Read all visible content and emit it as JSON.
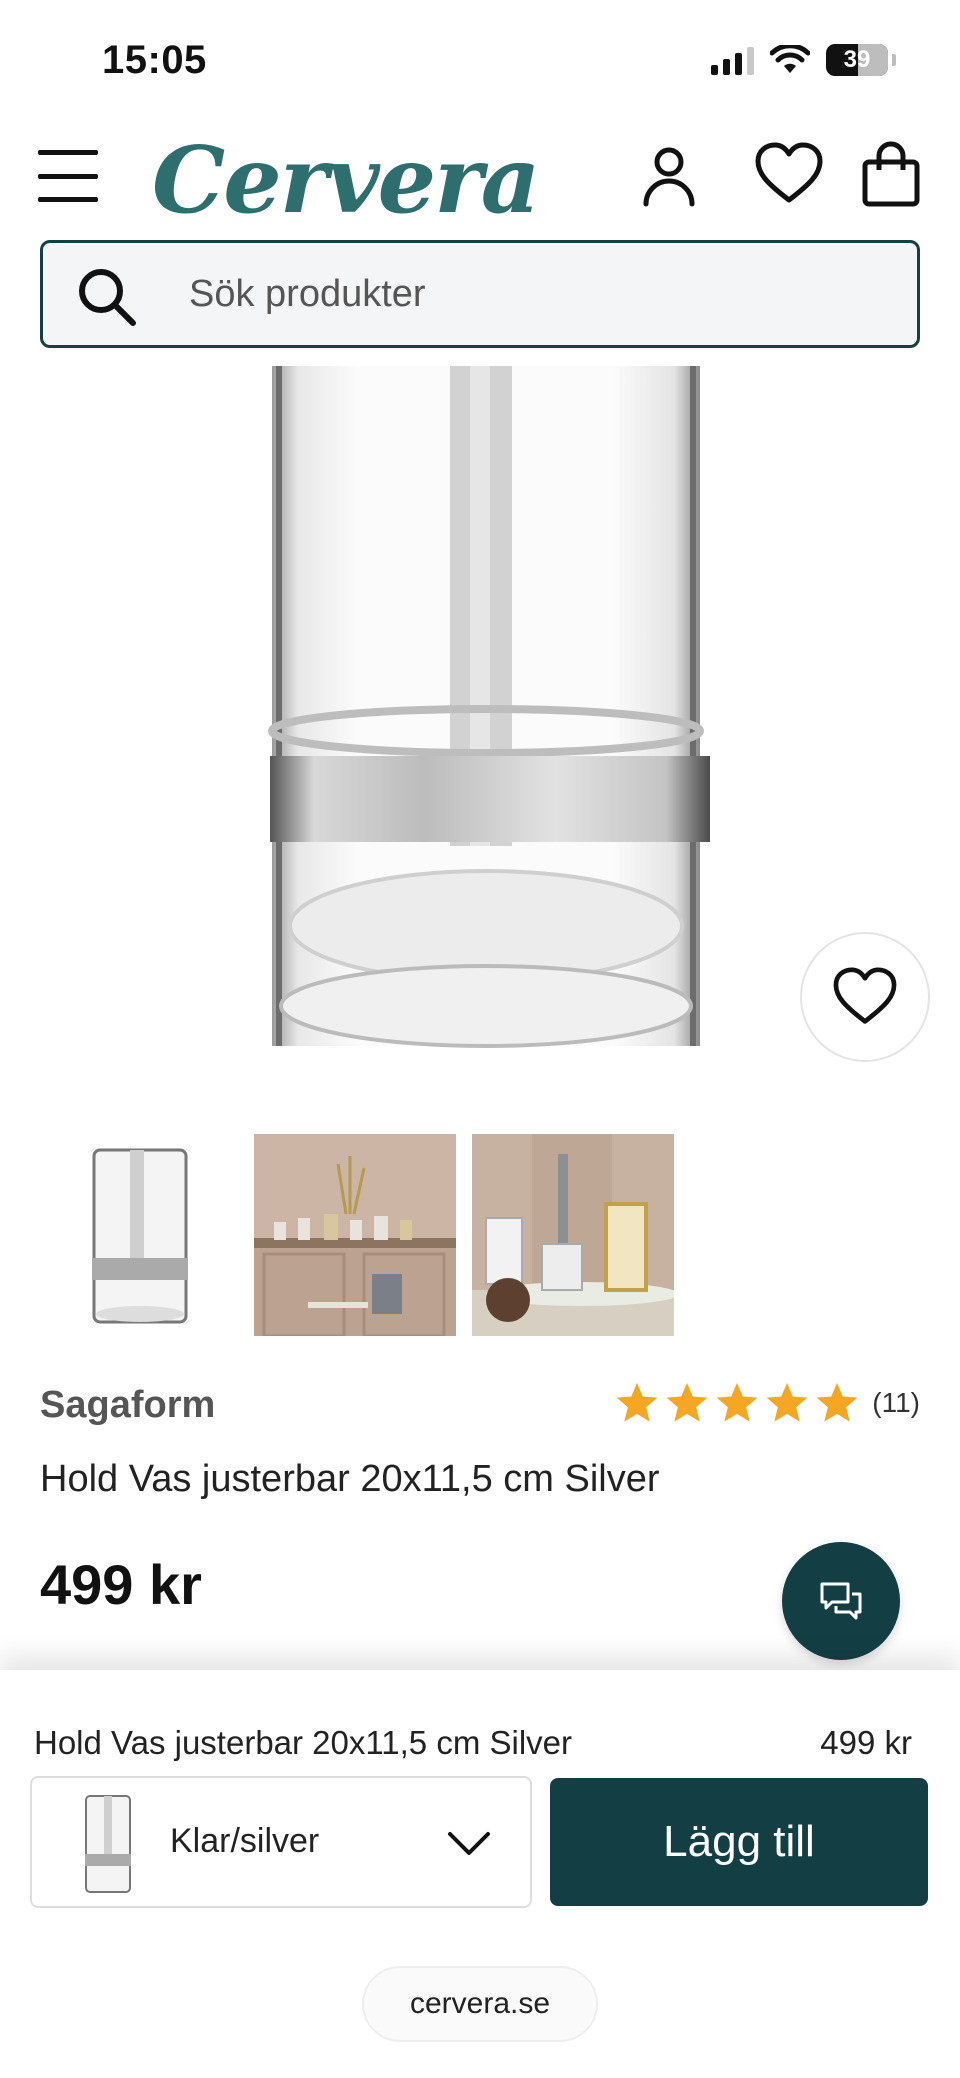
{
  "status_bar": {
    "time": "15:05",
    "battery": "39"
  },
  "header": {
    "logo": "Cervera"
  },
  "search": {
    "placeholder": "Sök produkter"
  },
  "product": {
    "brand": "Sagaform",
    "rating_stars": 5,
    "review_count": "(11)",
    "title": "Hold Vas justerbar 20x11,5 cm Silver",
    "price": "499 kr"
  },
  "thumbnails": [
    {
      "name": "thumbnail-product"
    },
    {
      "name": "thumbnail-interior"
    },
    {
      "name": "thumbnail-table-setting"
    }
  ],
  "sticky_bar": {
    "title": "Hold Vas justerbar 20x11,5 cm Silver",
    "price": "499 kr",
    "variant": "Klar/silver",
    "add_button": "Lägg till"
  },
  "browser": {
    "url": "cervera.se"
  },
  "colors": {
    "brand": "#2f6e6f",
    "primary_dark": "#133f44",
    "star": "#f5a623"
  }
}
